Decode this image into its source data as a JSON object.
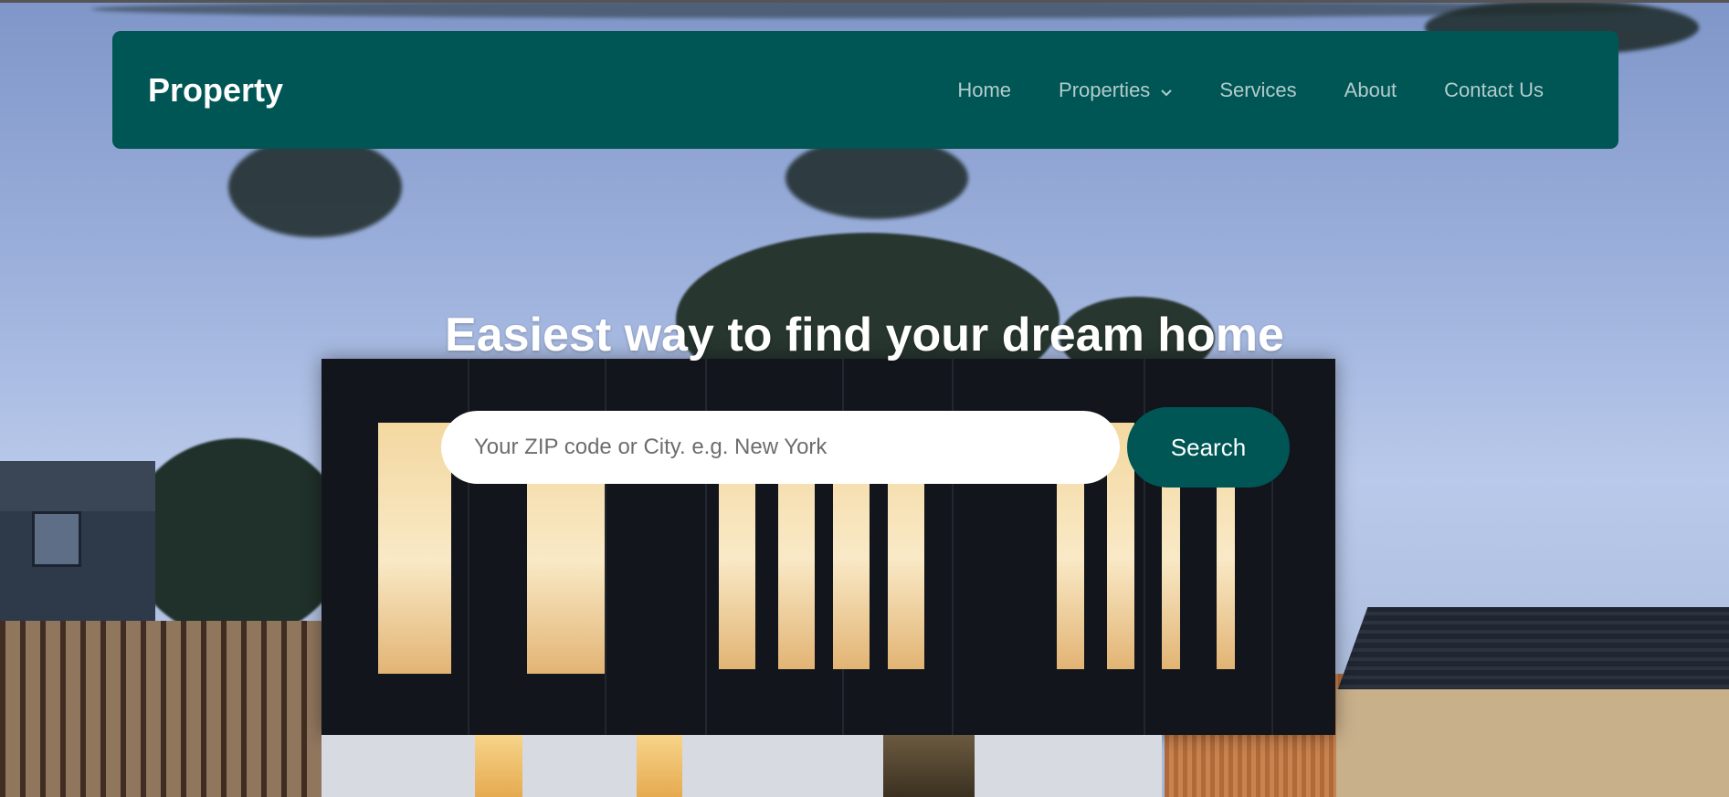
{
  "navbar": {
    "brand": "Property",
    "items": [
      {
        "label": "Home"
      },
      {
        "label": "Properties"
      },
      {
        "label": "Services"
      },
      {
        "label": "About"
      },
      {
        "label": "Contact Us"
      }
    ],
    "background_color": "#005555",
    "link_color": "#b3cccc"
  },
  "hero": {
    "title": "Easiest way to find your dream home",
    "search": {
      "placeholder": "Your ZIP code or City. e.g. New York",
      "value": "",
      "button_label": "Search"
    },
    "background_image": "modern-house-at-dusk"
  },
  "icons": {
    "properties_dropdown": "chevron-down-icon"
  },
  "colors": {
    "accent": "#005555",
    "text_light": "#ffffff"
  }
}
